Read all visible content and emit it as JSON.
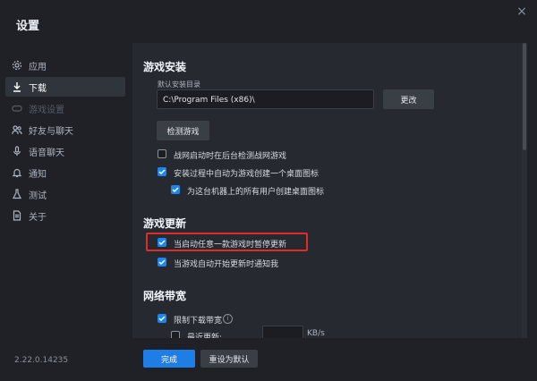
{
  "window": {
    "title": "设置",
    "close_icon": "×"
  },
  "sidebar": {
    "items": [
      {
        "label": "应用",
        "icon": "gear-icon",
        "state": "normal"
      },
      {
        "label": "下载",
        "icon": "download-icon",
        "state": "active"
      },
      {
        "label": "游戏设置",
        "icon": "gamepad-icon",
        "state": "disabled"
      },
      {
        "label": "好友与聊天",
        "icon": "friends-icon",
        "state": "normal"
      },
      {
        "label": "语音聊天",
        "icon": "microphone-icon",
        "state": "normal"
      },
      {
        "label": "通知",
        "icon": "bell-icon",
        "state": "normal"
      },
      {
        "label": "测试",
        "icon": "flask-icon",
        "state": "normal"
      },
      {
        "label": "关于",
        "icon": "document-icon",
        "state": "normal"
      }
    ],
    "version": "2.22.0.14235"
  },
  "game_install": {
    "title": "游戏安装",
    "dir_label": "默认安装目录",
    "dir_value": "C:\\Program Files (x86)\\",
    "change_button": "更改",
    "detect_button": "检测游戏",
    "options": [
      {
        "label": "战网启动时在后台检测战网游戏",
        "checked": false
      },
      {
        "label": "安装过程中自动为游戏创建一个桌面图标",
        "checked": true
      },
      {
        "label": "为这台机器上的所有用户创建桌面图标",
        "checked": true
      }
    ]
  },
  "game_update": {
    "title": "游戏更新",
    "options": [
      {
        "label": "当启动任意一款游戏时暂停更新",
        "checked": true,
        "highlighted": true
      },
      {
        "label": "当游戏自动开始更新时通知我",
        "checked": true
      }
    ]
  },
  "bandwidth": {
    "title": "网络带宽",
    "limit_label": "限制下载带宽",
    "limit_checked": true,
    "info_icon": "i",
    "recent_label": "最近更新:",
    "recent_checked": false,
    "recent_value": "",
    "unit": "KB/s"
  },
  "footer": {
    "done_button": "完成",
    "reset_button": "重设为默认"
  }
}
